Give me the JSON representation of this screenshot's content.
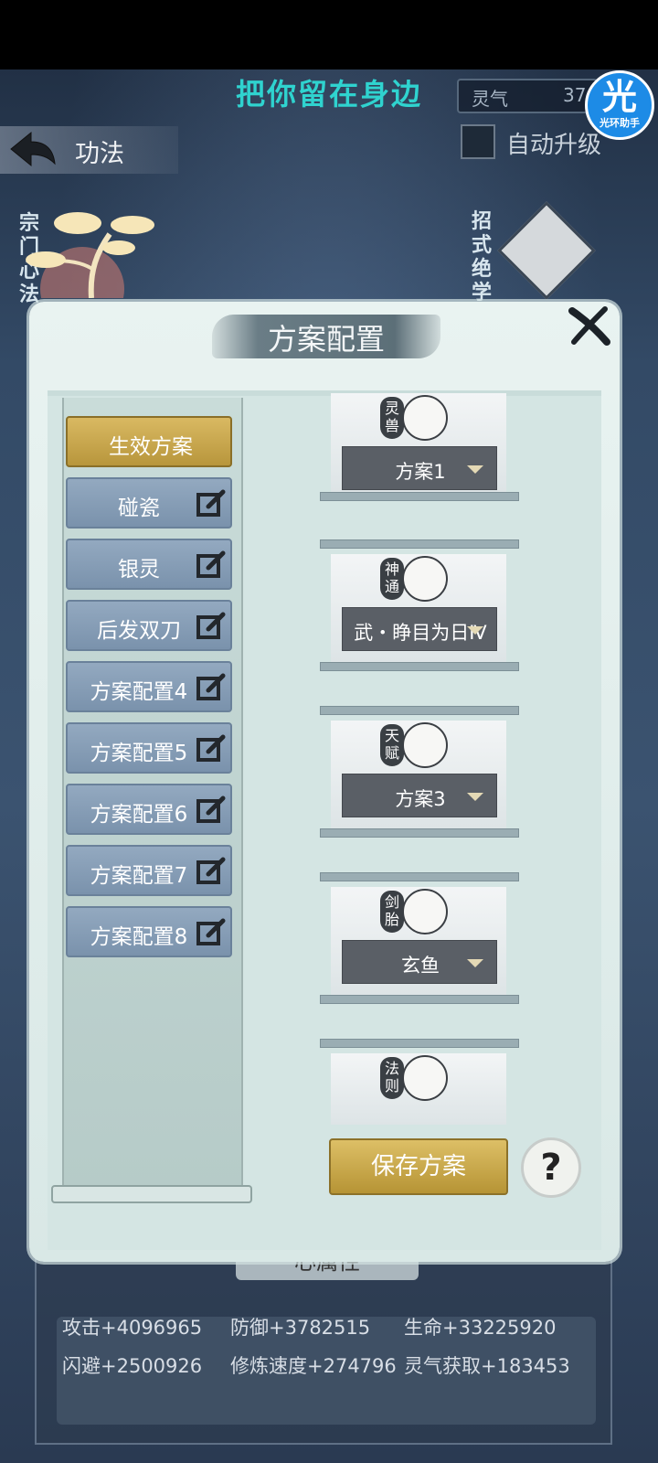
{
  "header": {
    "title": "把你留在身边",
    "resource_label": "灵气",
    "resource_value": "37",
    "back_title": "功法",
    "auto_upgrade_label": "自动升级",
    "assistant_glyph": "光",
    "assistant_label": "光环助手"
  },
  "background": {
    "left_section_label": "宗门心法",
    "right_section_label": "招式绝学"
  },
  "modal": {
    "title": "方案配置",
    "plans": [
      {
        "label": "生效方案",
        "active": true
      },
      {
        "label": "碰瓷"
      },
      {
        "label": "银灵"
      },
      {
        "label": "后发双刀"
      },
      {
        "label": "方案配置4"
      },
      {
        "label": "方案配置5"
      },
      {
        "label": "方案配置6"
      },
      {
        "label": "方案配置7"
      },
      {
        "label": "方案配置8"
      }
    ],
    "slots": [
      {
        "tag": "灵兽",
        "value": "方案1"
      },
      {
        "tag": "神通",
        "value": "武・睁目为日Ⅳ"
      },
      {
        "tag": "天赋",
        "value": "方案3"
      },
      {
        "tag": "剑胎",
        "value": "玄鱼"
      },
      {
        "tag": "法则",
        "value": ""
      }
    ],
    "save_label": "保存方案",
    "help_label": "?"
  },
  "attributes": {
    "section_label": "心属性",
    "items": [
      "攻击+4096965",
      "防御+3782515",
      "生命+33225920",
      "闪避+2500926",
      "修炼速度+274796",
      "灵气获取+183453"
    ]
  },
  "colors": {
    "title_teal": "#2fd3cf",
    "gold_button": "#c9a94a",
    "plan_blue": "#8aa1ba"
  }
}
